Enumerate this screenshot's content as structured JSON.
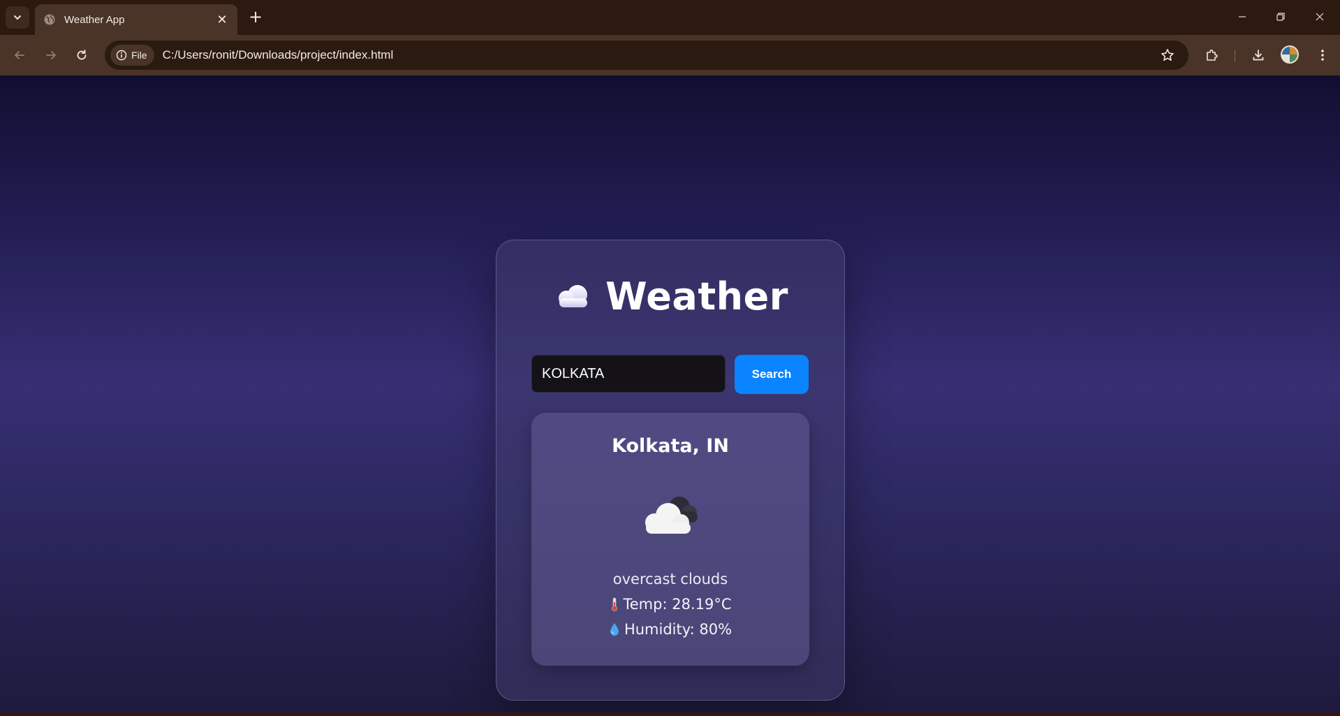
{
  "browser": {
    "tab_title": "Weather App",
    "chip_label": "File",
    "url": "C:/Users/ronit/Downloads/project/index.html"
  },
  "app": {
    "title": "Weather",
    "search": {
      "value": "KOLKATA",
      "button_label": "Search"
    },
    "result": {
      "city": "Kolkata, IN",
      "description": "overcast clouds",
      "temp": "Temp: 28.19°C",
      "humidity": "Humidity: 80%"
    }
  },
  "colors": {
    "accent": "#0a84ff",
    "chrome": "#4a3428",
    "card_text": "#ffffff"
  }
}
